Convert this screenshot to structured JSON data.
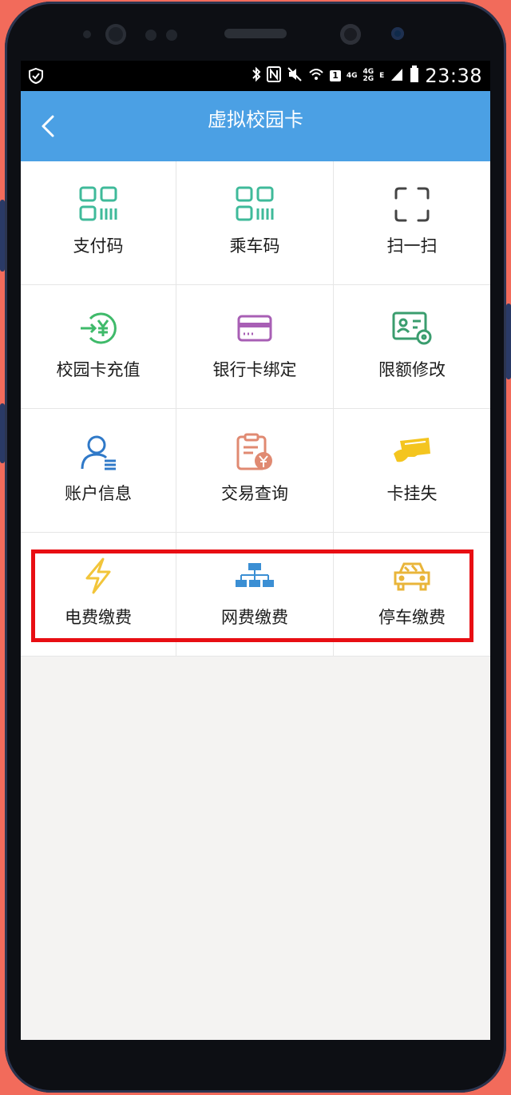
{
  "status_bar": {
    "time": "23:38",
    "sim_badge": "1",
    "network_4g": "4G",
    "network_4g2g_top": "4G",
    "network_4g2g_bottom": "2G",
    "network_e": "E",
    "icons": [
      "shield-check-icon",
      "bluetooth-icon",
      "nfc-icon",
      "mute-icon",
      "wifi-icon",
      "signal-icon",
      "battery-icon"
    ]
  },
  "header": {
    "title": "虚拟校园卡",
    "back_icon": "chevron-left-icon",
    "color": "#4ba0e4"
  },
  "grid": {
    "items": [
      {
        "label": "支付码",
        "icon": "qr-code-icon",
        "color": "#3fba9a"
      },
      {
        "label": "乘车码",
        "icon": "qr-code-icon",
        "color": "#3fba9a"
      },
      {
        "label": "扫一扫",
        "icon": "scan-frame-icon",
        "color": "#444444"
      },
      {
        "label": "校园卡充值",
        "icon": "recharge-yen-icon",
        "color": "#3fba6a"
      },
      {
        "label": "银行卡绑定",
        "icon": "bank-card-icon",
        "color": "#a85fb5"
      },
      {
        "label": "限额修改",
        "icon": "id-card-settings-icon",
        "color": "#3a9d6e"
      },
      {
        "label": "账户信息",
        "icon": "user-account-icon",
        "color": "#2f79c8"
      },
      {
        "label": "交易查询",
        "icon": "transaction-query-icon",
        "color": "#e08a72"
      },
      {
        "label": "卡挂失",
        "icon": "card-loss-icon",
        "color": "#f4c51f"
      },
      {
        "label": "电费缴费",
        "icon": "lightning-icon",
        "color": "#f2c53a"
      },
      {
        "label": "网费缴费",
        "icon": "network-hierarchy-icon",
        "color": "#3b8fd4"
      },
      {
        "label": "停车缴费",
        "icon": "car-icon",
        "color": "#e9b53a"
      }
    ]
  },
  "highlight_color": "#e80e13"
}
